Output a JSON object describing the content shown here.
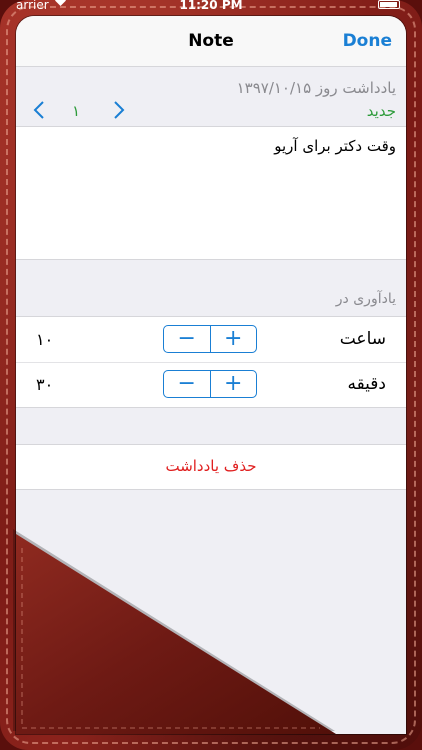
{
  "status_bar": {
    "carrier": "arrier",
    "time": "11:20 PM"
  },
  "navbar": {
    "title": "Note",
    "done_label": "Done"
  },
  "note": {
    "date_label": "یادداشت روز ۱۳۹۷/۱۰/۱۵",
    "status": "جدید",
    "page_number": "۱",
    "text": "وقت دکتر برای آریو"
  },
  "reminder": {
    "section_label": "یادآوری در",
    "hour": {
      "label": "ساعت",
      "value": "۱۰"
    },
    "minute": {
      "label": "دقیقه",
      "value": "۳۰"
    },
    "plus_label": "+",
    "minus_label": "−"
  },
  "delete_label": "حذف یادداشت",
  "colors": {
    "accent": "#1a7fd4",
    "new_status": "#2e9b3b",
    "delete": "#e02020",
    "leather": "#7a1a15"
  },
  "icons": {
    "back": "chevron-left-icon",
    "forward": "chevron-right-icon",
    "wifi": "wifi-icon",
    "battery": "battery-icon"
  }
}
